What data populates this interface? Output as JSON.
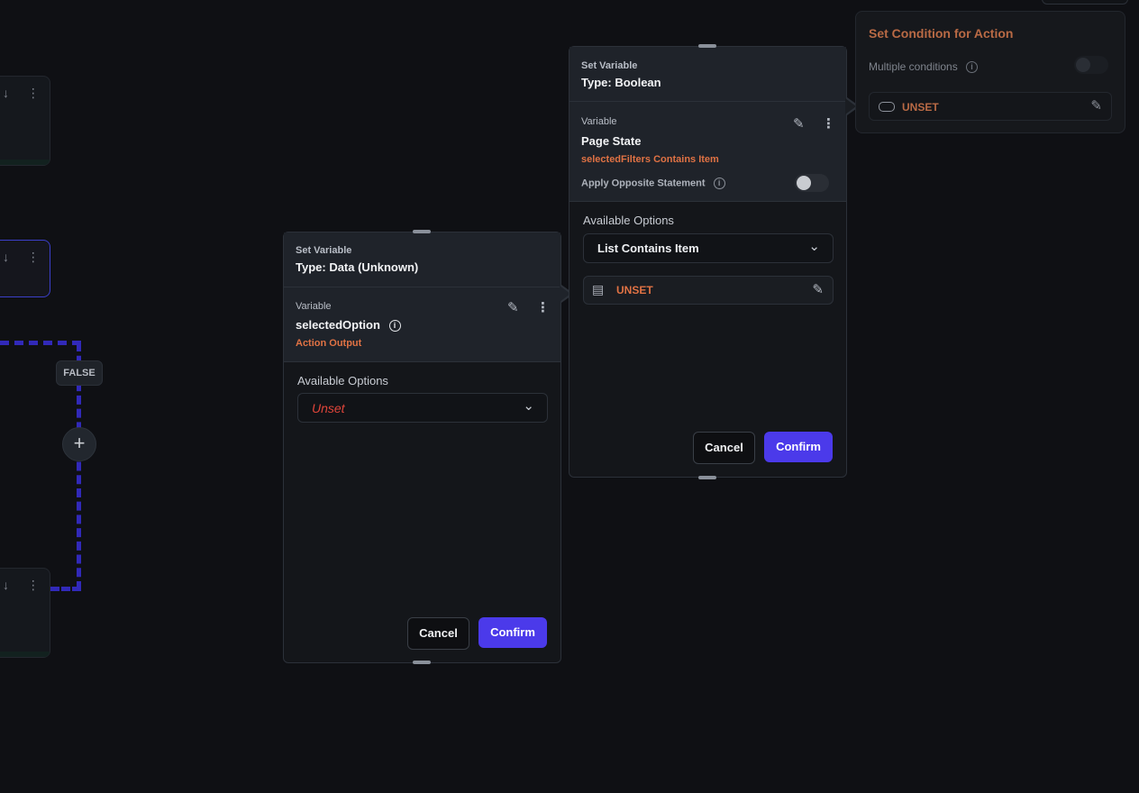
{
  "canvas": {
    "false_badge": "FALSE",
    "plus_label": "+"
  },
  "panel_data": {
    "header": {
      "kicker": "Set Variable",
      "type": "Type: Data (Unknown)"
    },
    "variable": {
      "kicker": "Variable",
      "name": "selectedOption",
      "source": "Action Output"
    },
    "options": {
      "label": "Available Options",
      "selected": "Unset"
    },
    "cancel": "Cancel",
    "confirm": "Confirm"
  },
  "panel_boolean": {
    "header": {
      "kicker": "Set Variable",
      "type": "Type: Boolean"
    },
    "variable": {
      "kicker": "Variable",
      "name": "Page State",
      "source": "selectedFilters Contains Item",
      "opposite_label": "Apply Opposite Statement",
      "opposite_on": false
    },
    "options": {
      "label": "Available Options",
      "selected": "List Contains Item"
    },
    "item_value": "UNSET",
    "cancel": "Cancel",
    "confirm": "Confirm"
  },
  "panel_condition": {
    "title": "Set Condition for Action",
    "multiple_label": "Multiple conditions",
    "multiple_on": false,
    "value": "UNSET"
  },
  "colors": {
    "accent": "#4b3aea",
    "unset_orange": "#e07244",
    "unset_red": "#e0453a",
    "connector": "#3129b9"
  }
}
